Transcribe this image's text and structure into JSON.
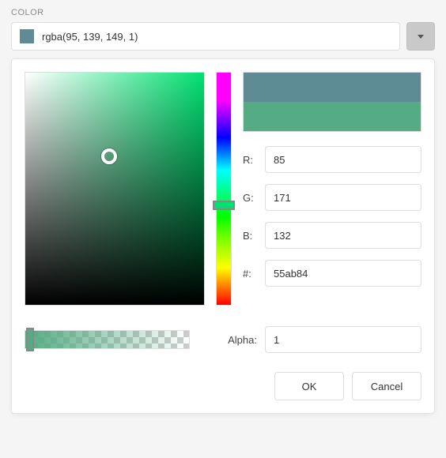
{
  "field_label": "COLOR",
  "input_value": "rgba(95, 139, 149, 1)",
  "preview": {
    "old": "#5f8b95",
    "new": "#55ab84"
  },
  "channels": {
    "r_label": "R:",
    "g_label": "G:",
    "b_label": "B:",
    "hex_label": "#:",
    "r": "85",
    "g": "171",
    "b": "132",
    "hex": "55ab84"
  },
  "alpha": {
    "label": "Alpha:",
    "value": "1"
  },
  "buttons": {
    "ok": "OK",
    "cancel": "Cancel"
  }
}
